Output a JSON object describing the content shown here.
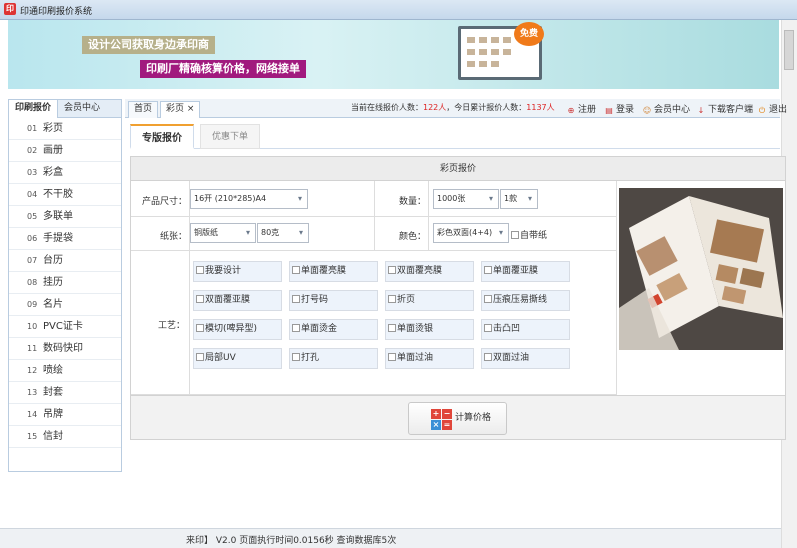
{
  "window": {
    "title": "印通印刷报价系统",
    "icon_text": "印"
  },
  "banner": {
    "line1": "设计公司获取身边承印商",
    "line2": "印刷厂精确核算价格，网络接单",
    "badge": "免费"
  },
  "sidebar": {
    "tabs": [
      "印刷报价",
      "会员中心"
    ],
    "items": [
      {
        "num": "01",
        "label": "彩页"
      },
      {
        "num": "02",
        "label": "画册"
      },
      {
        "num": "03",
        "label": "彩盒"
      },
      {
        "num": "04",
        "label": "不干胶"
      },
      {
        "num": "05",
        "label": "多联单"
      },
      {
        "num": "06",
        "label": "手提袋"
      },
      {
        "num": "07",
        "label": "台历"
      },
      {
        "num": "08",
        "label": "挂历"
      },
      {
        "num": "09",
        "label": "名片"
      },
      {
        "num": "10",
        "label": "PVC证卡"
      },
      {
        "num": "11",
        "label": "数码快印"
      },
      {
        "num": "12",
        "label": "喷绘"
      },
      {
        "num": "13",
        "label": "封套"
      },
      {
        "num": "14",
        "label": "吊牌"
      },
      {
        "num": "15",
        "label": "信封"
      }
    ]
  },
  "topbar": {
    "tabs": {
      "home": "首页",
      "current": "彩页",
      "close": "×"
    },
    "online_label": "当前在线报价人数：",
    "online_count": "122人",
    "today_label": "，今日累计报价人数：",
    "today_count": "1137人",
    "links": {
      "register": "注册",
      "login": "登录",
      "member": "会员中心",
      "download": "下载客户端",
      "exit": "退出"
    }
  },
  "subtabs": [
    "专版报价",
    "优惠下单"
  ],
  "form": {
    "panel_title": "彩页报价",
    "size_label": "产品尺寸：",
    "size_value": "16开 (210*285)A4",
    "qty_label": "数量：",
    "qty_value": "1000张",
    "styles_value": "1款",
    "paper_label": "纸张：",
    "paper_value": "铜版纸",
    "weight_value": "80克",
    "color_label": "颜色：",
    "color_value": "彩色双面(4+4)",
    "self_paper": "自带纸",
    "craft_label": "工艺：",
    "crafts": [
      "我要设计",
      "单面覆亮膜",
      "双面覆亮膜",
      "单面覆亚膜",
      "双面覆亚膜",
      "打号码",
      "折页",
      "压痕压易撕线",
      "模切(啤异型)",
      "单面烫金",
      "单面烫银",
      "击凸凹",
      "局部UV",
      "打孔",
      "单面过油",
      "双面过油"
    ]
  },
  "calc_button": {
    "label": "计算价格",
    "icon_ops": [
      "+",
      "−",
      "×",
      "="
    ]
  },
  "status": {
    "text": "来印】 V2.0    页面执行时间0.0156秒    查询数据库5次"
  }
}
